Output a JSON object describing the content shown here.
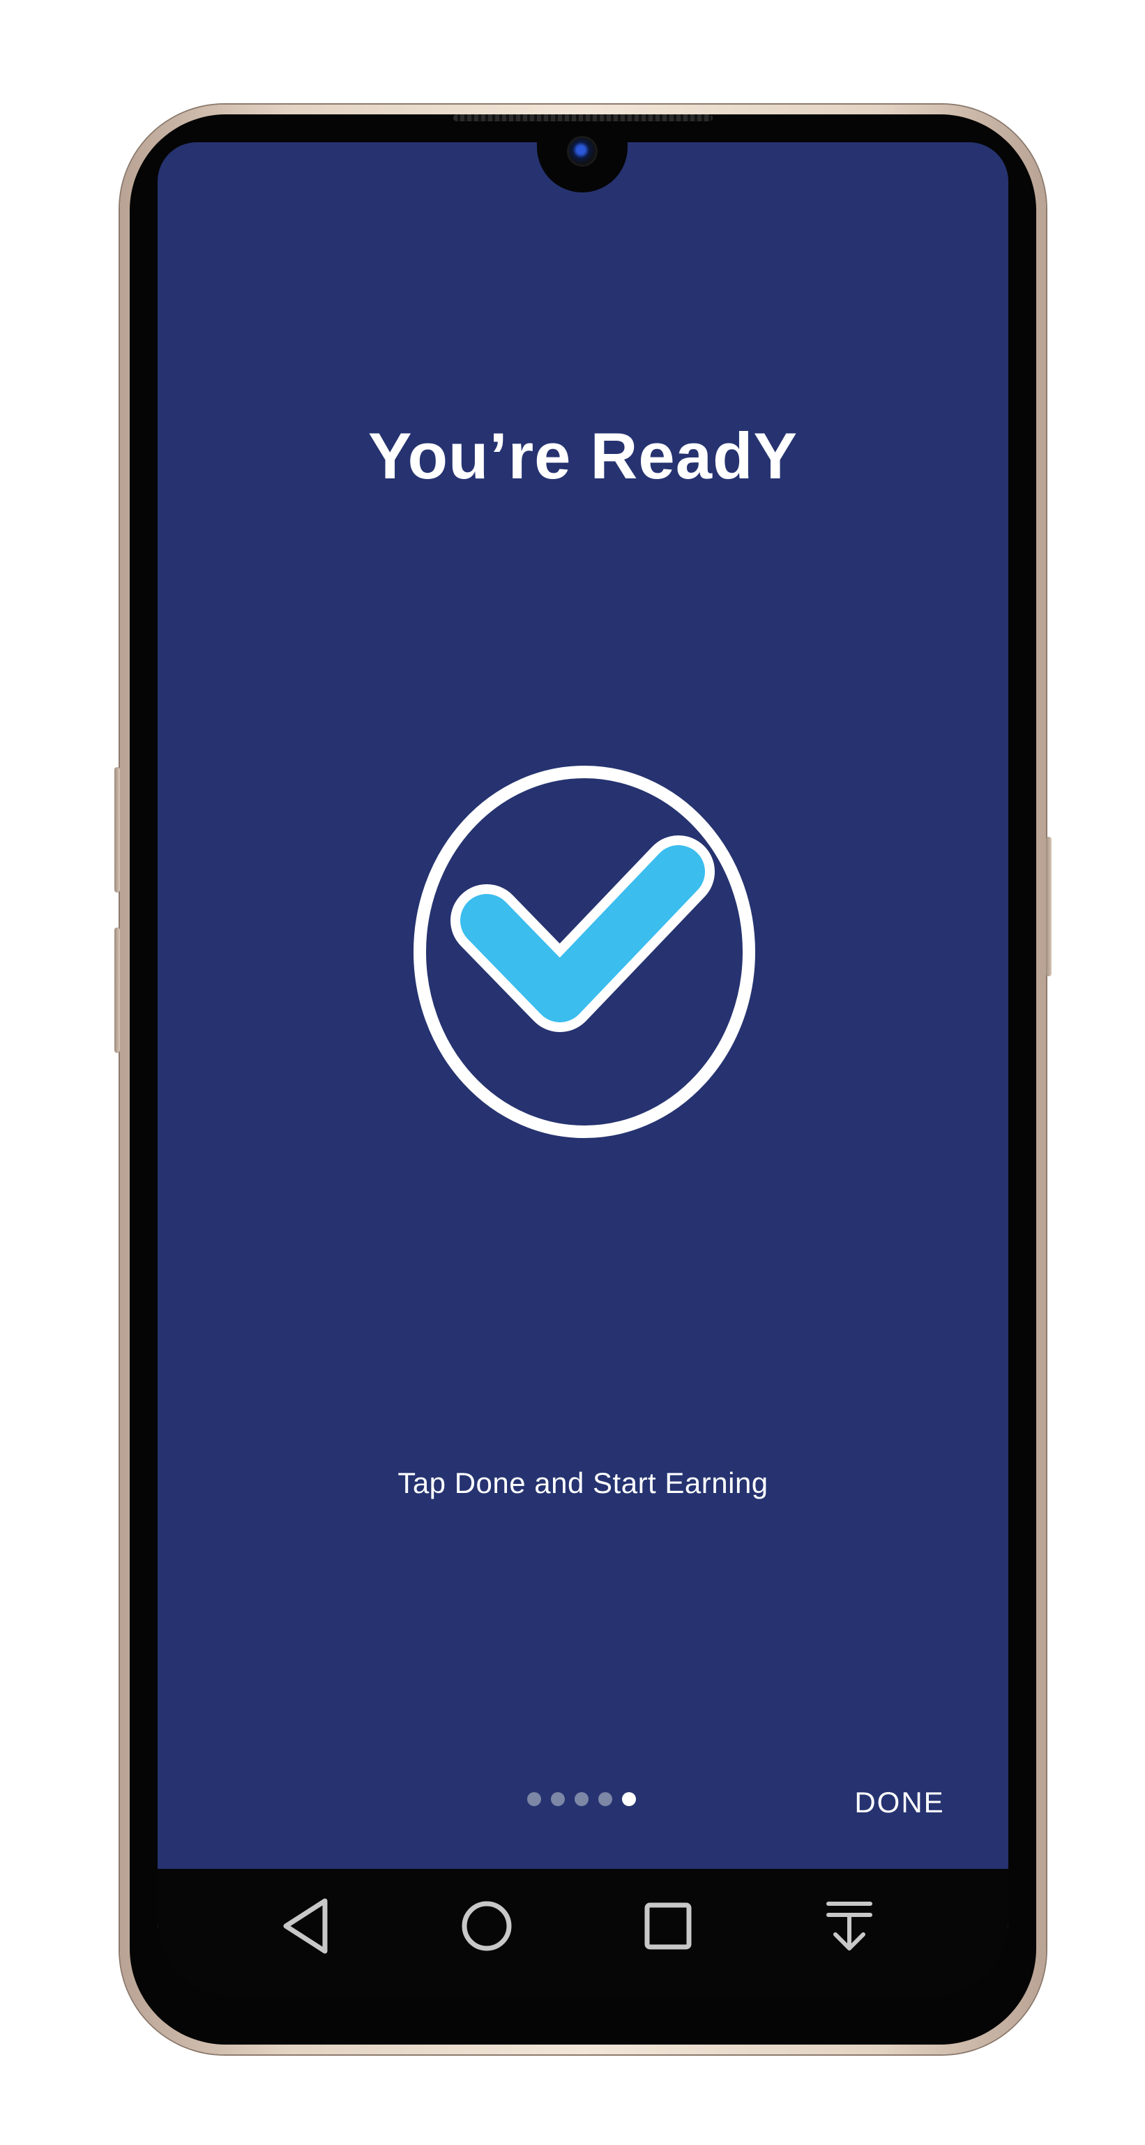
{
  "screen": {
    "background_color": "#263370",
    "title": "You’re ReadY",
    "subtitle": "Tap Done and Start Earning",
    "done_label": "DONE",
    "accent_color": "#3BBDEE"
  },
  "pager": {
    "total": 5,
    "current": 5
  },
  "nav_bar": {
    "icons": [
      "back-icon",
      "home-icon",
      "recents-icon",
      "notifications-pull-icon"
    ]
  }
}
